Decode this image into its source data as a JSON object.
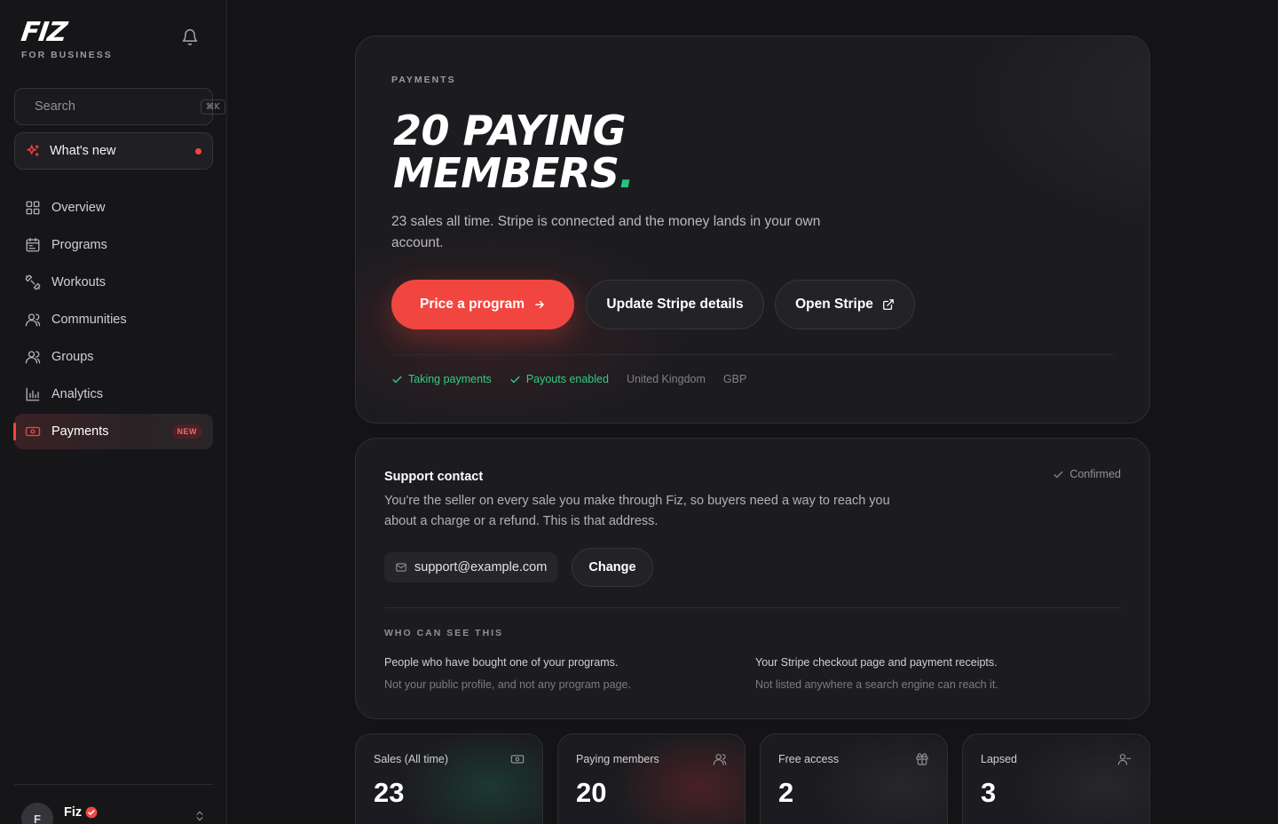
{
  "brand": {
    "logo": "FIZ",
    "subtitle": "FOR BUSINESS"
  },
  "search": {
    "placeholder": "Search",
    "shortcut": "⌘K"
  },
  "whats_new": {
    "label": "What's new"
  },
  "nav": {
    "items": [
      {
        "label": "Overview",
        "icon": "grid-icon"
      },
      {
        "label": "Programs",
        "icon": "calendar-icon"
      },
      {
        "label": "Workouts",
        "icon": "dumbbell-icon"
      },
      {
        "label": "Communities",
        "icon": "users-icon"
      },
      {
        "label": "Groups",
        "icon": "users-icon"
      },
      {
        "label": "Analytics",
        "icon": "bar-chart-icon"
      },
      {
        "label": "Payments",
        "icon": "banknote-icon",
        "badge": "NEW",
        "active": true
      }
    ]
  },
  "user": {
    "initial": "F",
    "name": "Fiz"
  },
  "hero": {
    "eyebrow": "PAYMENTS",
    "title_line1": "20 PAYING",
    "title_line2": "MEMBERS",
    "title_dot": ".",
    "description": "23 sales all time. Stripe is connected and the money lands in your own account.",
    "primary_button": "Price a program",
    "secondary_button": "Update Stripe details",
    "tertiary_button": "Open Stripe",
    "status": {
      "taking_payments": "Taking payments",
      "payouts_enabled": "Payouts enabled",
      "country": "United Kingdom",
      "currency": "GBP"
    }
  },
  "support": {
    "title": "Support contact",
    "confirmed": "Confirmed",
    "description": "You're the seller on every sale you make through Fiz, so buyers need a way to reach you about a charge or a refund. This is that address.",
    "email": "support@example.com",
    "change_button": "Change",
    "who_title": "WHO CAN SEE THIS",
    "who_left_primary": "People who have bought one of your programs.",
    "who_left_secondary": "Not your public profile, and not any program page.",
    "who_right_primary": "Your Stripe checkout page and payment receipts.",
    "who_right_secondary": "Not listed anywhere a search engine can reach it."
  },
  "stats": [
    {
      "label": "Sales (All time)",
      "value": "23",
      "icon": "banknote-icon"
    },
    {
      "label": "Paying members",
      "value": "20",
      "icon": "users-icon"
    },
    {
      "label": "Free access",
      "value": "2",
      "icon": "gift-icon"
    },
    {
      "label": "Lapsed",
      "value": "3",
      "icon": "user-minus-icon"
    }
  ],
  "colors": {
    "accent": "#f0463f",
    "success": "#2fcd85",
    "background": "#141417"
  }
}
